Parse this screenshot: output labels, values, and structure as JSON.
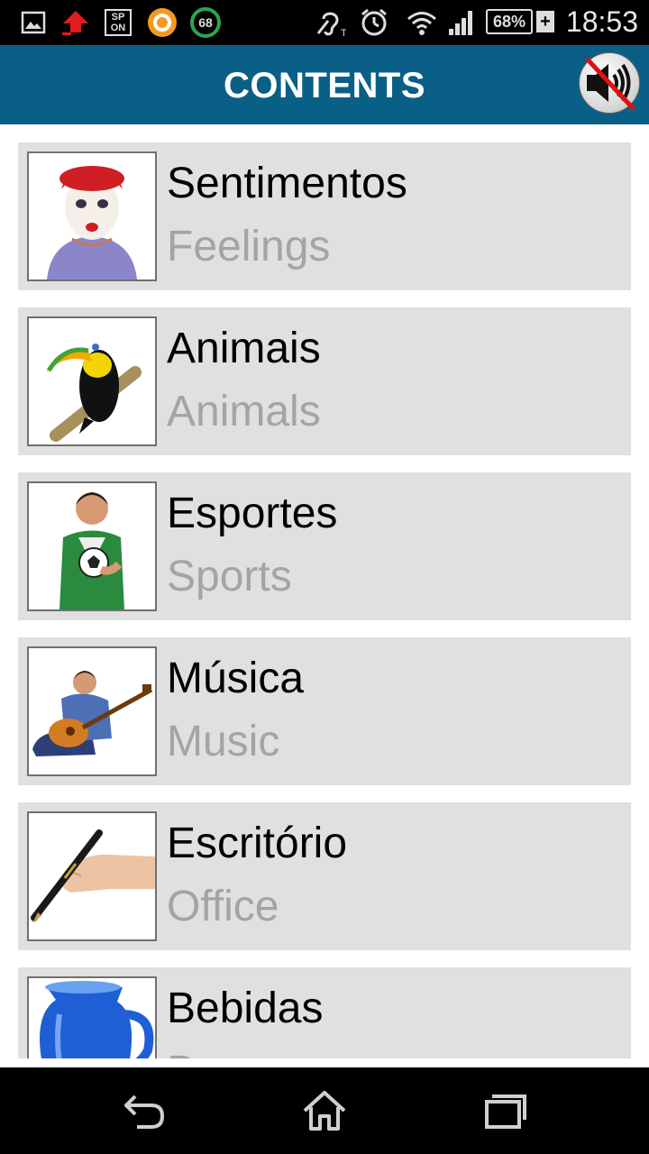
{
  "status_bar": {
    "icons": [
      "gallery-icon",
      "upload-icon",
      "sp-on-icon",
      "app-circle-icon",
      "gauge-68-icon",
      "hearing-aid-icon",
      "alarm-icon",
      "wifi-icon",
      "signal-icon"
    ],
    "badge_value": "68",
    "sp_label_top": "SP",
    "sp_label_bottom": "ON",
    "battery_percent": "68%",
    "battery_charging_symbol": "+",
    "time": "18:53"
  },
  "app_bar": {
    "title": "CONTENTS",
    "mute_icon": "speaker-muted-icon",
    "color": "#0a5f86"
  },
  "categories": [
    {
      "portuguese": "Sentimentos",
      "english": "Feelings",
      "image": "clown-face-image"
    },
    {
      "portuguese": "Animais",
      "english": "Animals",
      "image": "toucan-image"
    },
    {
      "portuguese": "Esportes",
      "english": "Sports",
      "image": "soccer-player-image"
    },
    {
      "portuguese": "Música",
      "english": "Music",
      "image": "guitar-player-image"
    },
    {
      "portuguese": "Escritório",
      "english": "Office",
      "image": "hand-writing-pen-image"
    },
    {
      "portuguese": "Bebidas",
      "english": "Beverages",
      "image": "blue-pitcher-image"
    }
  ],
  "nav_bar": {
    "back": "back-icon",
    "home": "home-icon",
    "recents": "recents-icon"
  }
}
